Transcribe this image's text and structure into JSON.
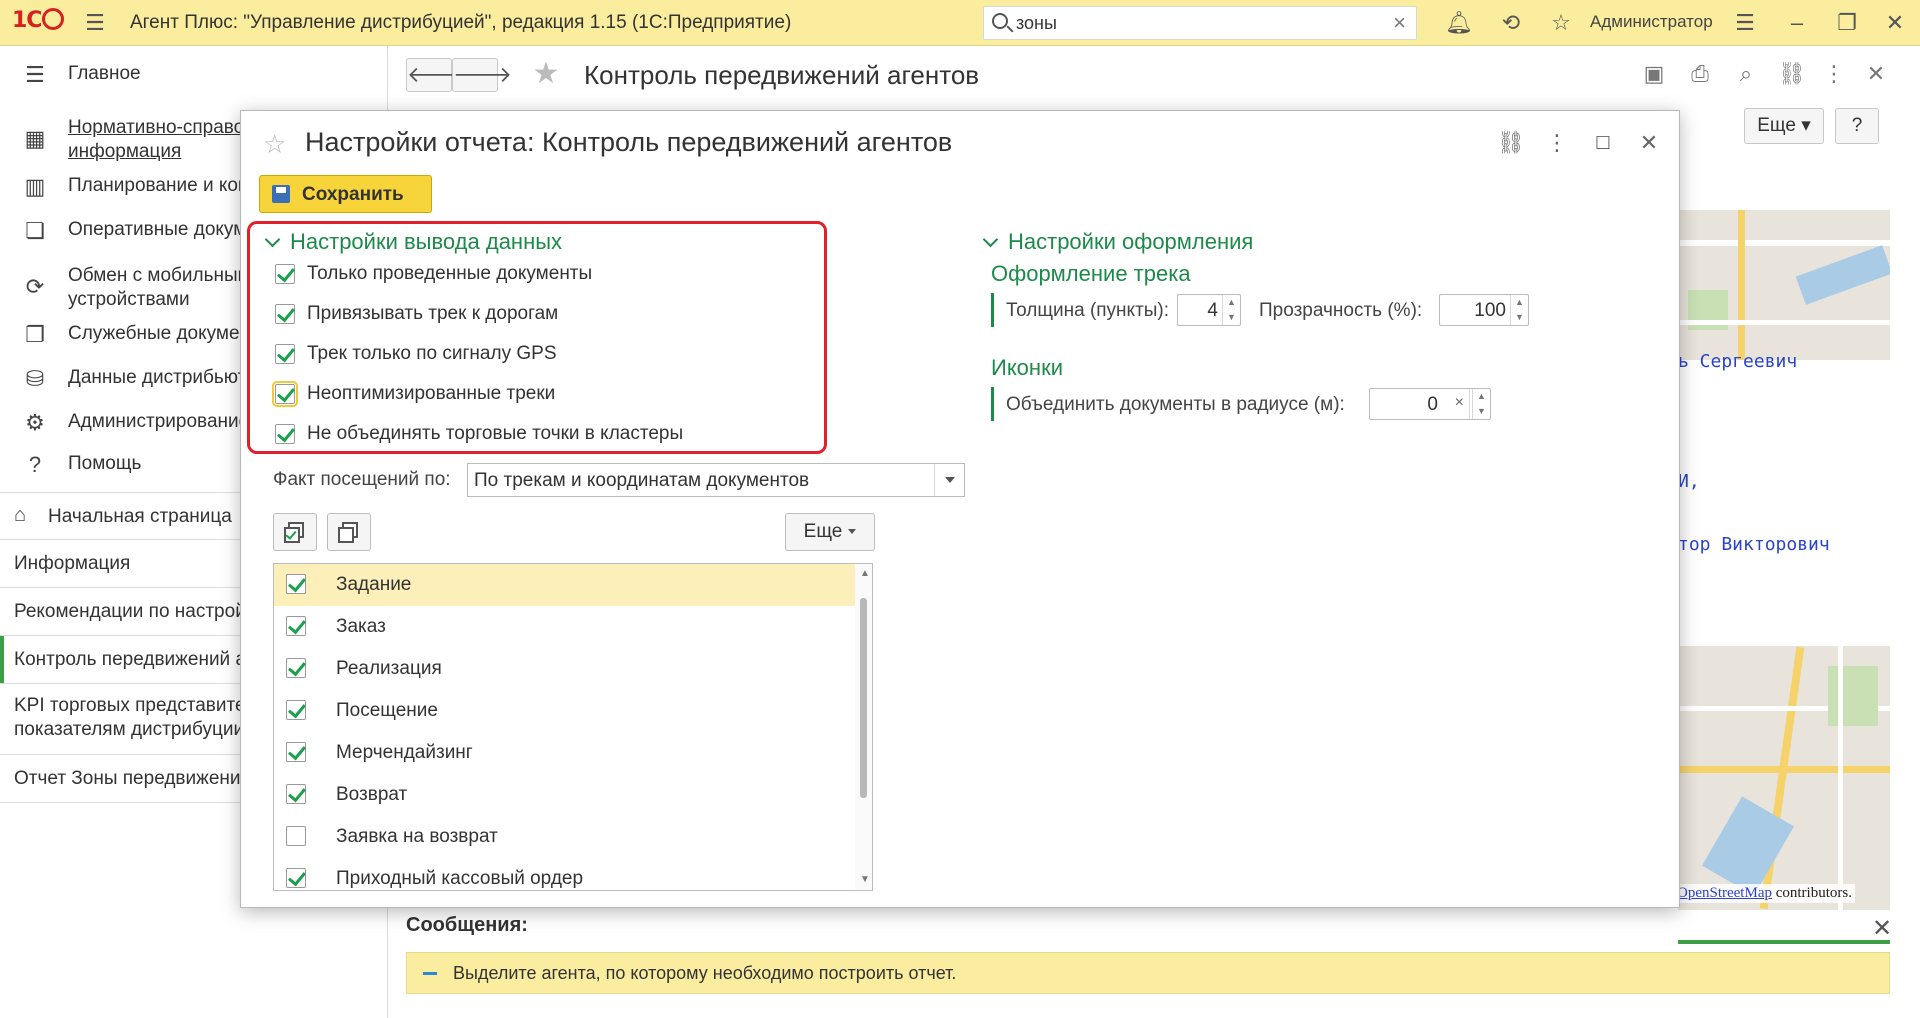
{
  "app": {
    "logo": "1С",
    "title": "Агент Плюс: \"Управление дистрибуцией\", редакция 1.15  (1С:Предприятие)",
    "search_value": "зоны",
    "user": "Администратор"
  },
  "nav": {
    "sections": [
      {
        "label": "Главное",
        "icon": "menu-lines-icon"
      },
      {
        "label": "Нормативно-справочная",
        "label2": "информация",
        "icon": "table-icon"
      },
      {
        "label": "Планирование и контроль",
        "icon": "bar-chart-icon"
      },
      {
        "label": "Оперативные документы",
        "icon": "documents-icon"
      },
      {
        "label": "Обмен с мобильными",
        "label2": "устройствами",
        "icon": "sync-icon"
      },
      {
        "label": "Служебные документы",
        "icon": "service-docs-icon"
      },
      {
        "label": "Данные дистрибьюторов",
        "icon": "database-icon"
      },
      {
        "label": "Администрирование",
        "icon": "gear-icon"
      },
      {
        "label": "Помощь",
        "icon": "question-icon"
      }
    ],
    "open_windows": [
      {
        "label": "Начальная страница"
      },
      {
        "label": "Информация"
      },
      {
        "label": "Рекомендации по настройке"
      },
      {
        "label": "Контроль передвижений агентов"
      },
      {
        "label": "KPI торговых представителей по",
        "label2": "показателям дистрибуции"
      },
      {
        "label": "Отчет Зоны передвижений"
      }
    ]
  },
  "main": {
    "title": "Контроль передвижений агентов",
    "more": "Еще",
    "help": "?",
    "agents": [
      "ь Сергеевич",
      "И,",
      "тор Викторович"
    ],
    "osm_link": "OpenStreetMap",
    "osm_suffix": " contributors.",
    "messages_title": "Сообщения:",
    "message": "Выделите агента, по которому необходимо построить отчет."
  },
  "dialog": {
    "title": "Настройки отчета: Контроль передвижений агентов",
    "save": "Сохранить",
    "output_group": "Настройки вывода данных",
    "output_options": [
      {
        "label": "Только проведенные документы",
        "checked": true
      },
      {
        "label": "Привязывать трек к дорогам",
        "checked": true
      },
      {
        "label": "Трек только по сигналу GPS",
        "checked": true
      },
      {
        "label": "Неоптимизированные треки",
        "checked": true
      },
      {
        "label": "Не объединять торговые точки в кластеры",
        "checked": true
      }
    ],
    "design_group": "Настройки оформления",
    "track_design": "Оформление трека",
    "thickness_label": "Толщина (пункты):",
    "thickness_value": "4",
    "transparency_label": "Прозрачность (%):",
    "transparency_value": "100",
    "icons_group": "Иконки",
    "radius_label": "Объединить документы в радиусе (м):",
    "radius_value": "0",
    "visits_label": "Факт посещений по:",
    "visits_value": "По трекам и координатам документов",
    "more": "Еще",
    "doc_types": [
      {
        "label": "Задание",
        "checked": true
      },
      {
        "label": "Заказ",
        "checked": true
      },
      {
        "label": "Реализация",
        "checked": true
      },
      {
        "label": "Посещение",
        "checked": true
      },
      {
        "label": "Мерчендайзинг",
        "checked": true
      },
      {
        "label": "Возврат",
        "checked": true
      },
      {
        "label": "Заявка на возврат",
        "checked": false
      },
      {
        "label": "Приходный кассовый ордер",
        "checked": true
      }
    ]
  }
}
